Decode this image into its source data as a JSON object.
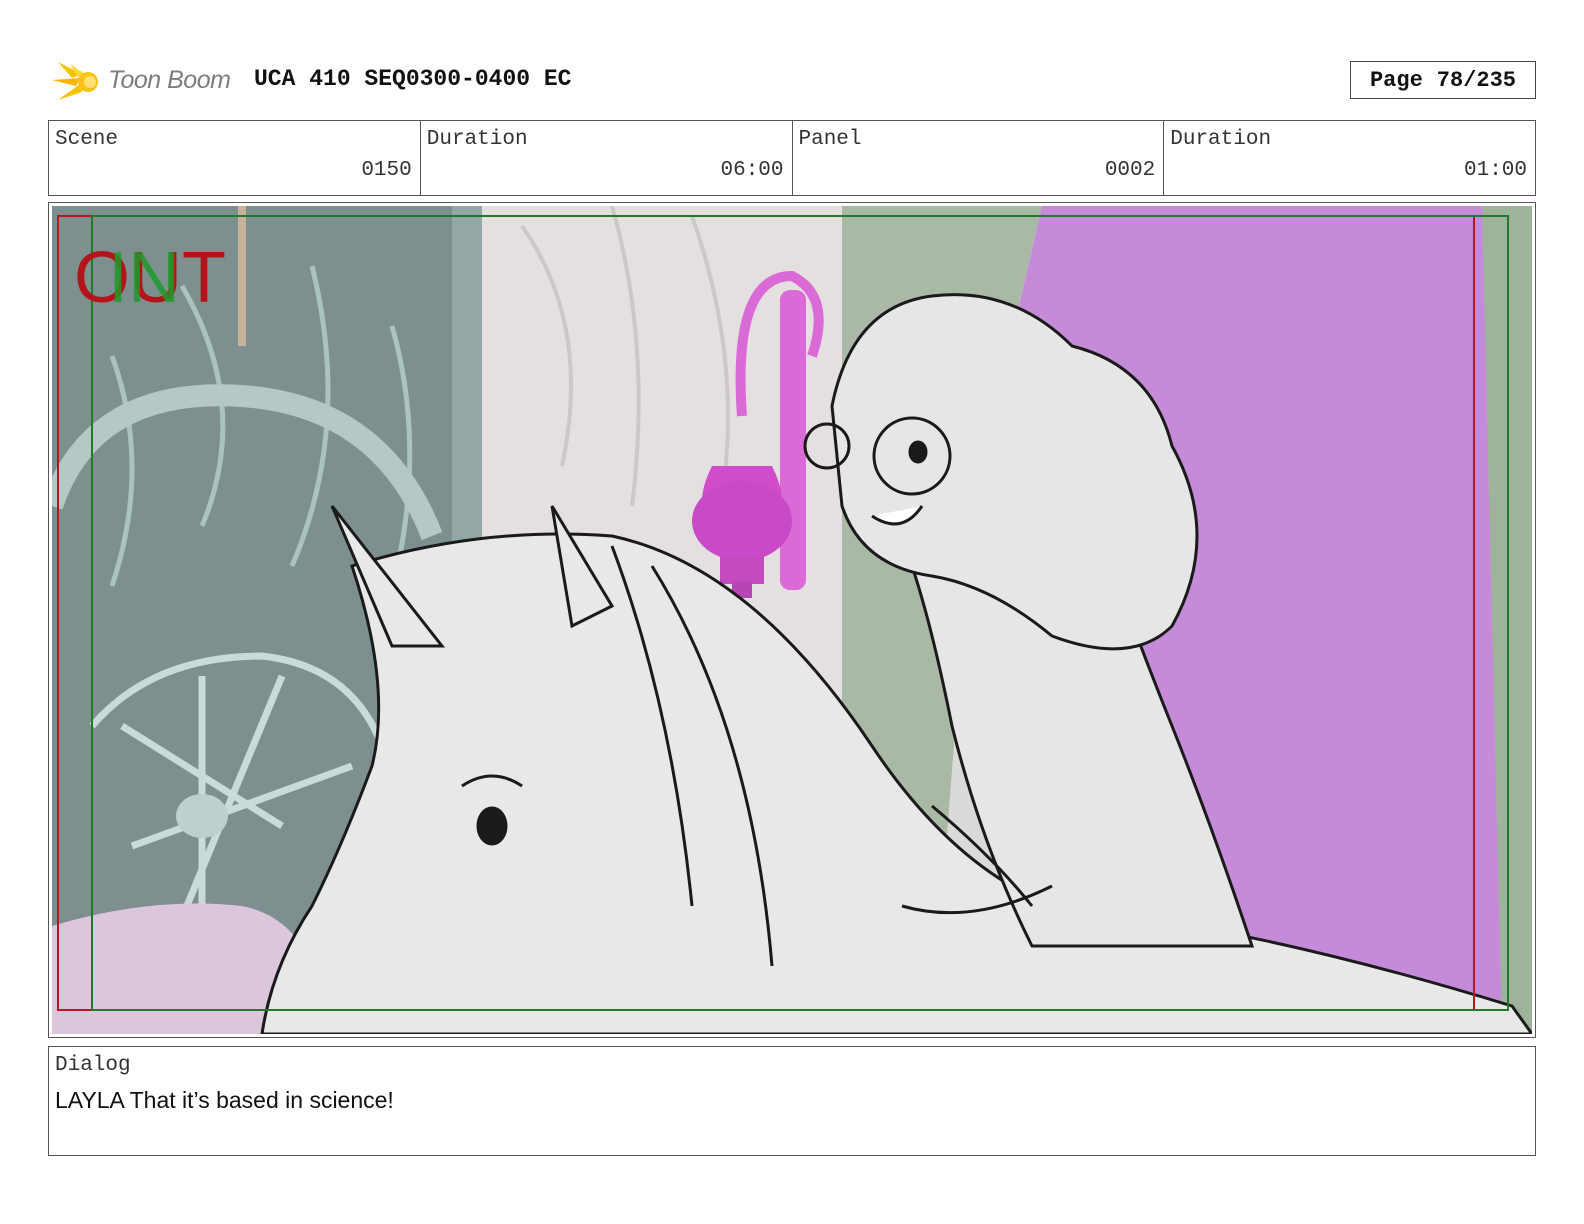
{
  "header": {
    "logo_text": "Toon Boom",
    "project_title": "UCA 410 SEQ0300-0400 EC",
    "page_label": "Page",
    "page_value": "78/235"
  },
  "info": [
    {
      "label": "Scene",
      "value": "0150"
    },
    {
      "label": "Duration",
      "value": "06:00"
    },
    {
      "label": "Panel",
      "value": "0002"
    },
    {
      "label": "Duration",
      "value": "01:00"
    }
  ],
  "panel": {
    "out_label_red": "OUT",
    "out_label_green": "IN",
    "colors": {
      "wall_purple": "#c58bd9",
      "lamp_magenta": "#d96ad6",
      "frame_red": "#c0141c",
      "frame_green": "#1f7a2a",
      "dark_wall": "#7f9090"
    }
  },
  "dialog": {
    "label": "Dialog",
    "text": "LAYLA  That it’s based in science!"
  }
}
